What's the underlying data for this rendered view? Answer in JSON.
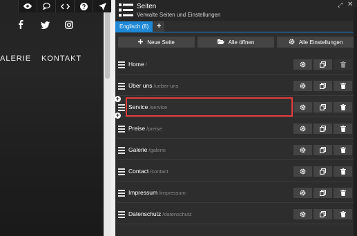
{
  "preview": {
    "social": [
      "facebook-icon",
      "twitter-icon",
      "instagram-icon"
    ],
    "nav": [
      "ALERIE",
      "KONTAKT"
    ]
  },
  "toolbar": {
    "items": [
      "eye-icon",
      "comment-icon",
      "code-icon",
      "help-icon",
      "pin-icon"
    ]
  },
  "panel": {
    "title": "Seiten",
    "subtitle": "Verwalte Seiten und Einstellungen",
    "tab_active": "Englisch (8)",
    "tab_add": "+",
    "actions": {
      "new_page": "Neue Seite",
      "open_all": "Alle öffnen",
      "all_settings": "Alle Einstellungen"
    },
    "pages": [
      {
        "name": "Home",
        "slug": "/"
      },
      {
        "name": "Über uns",
        "slug": "/ueber-uns"
      },
      {
        "name": "Service",
        "slug": "/service"
      },
      {
        "name": "Preise",
        "slug": "/preise"
      },
      {
        "name": "Galerie",
        "slug": "/galerie"
      },
      {
        "name": "Contact",
        "slug": "/contact"
      },
      {
        "name": "Impressum",
        "slug": "/impressum"
      },
      {
        "name": "Datenschutz",
        "slug": "/datenschutz"
      }
    ],
    "accent_color": "#1e88d6",
    "highlight_color": "#e53c3c"
  }
}
